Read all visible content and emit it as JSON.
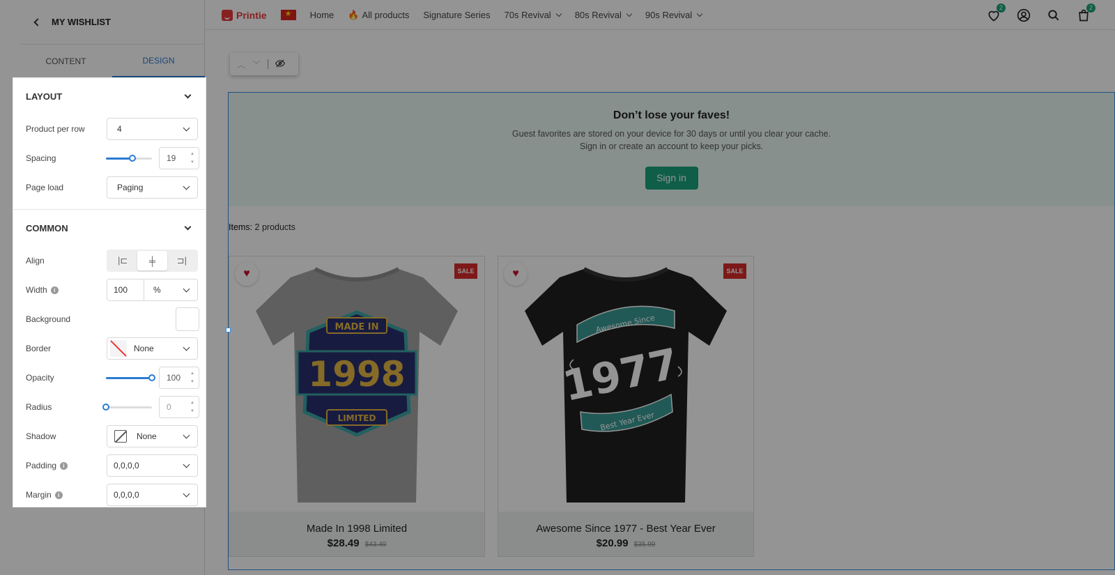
{
  "sidebar": {
    "title": "MY WISHLIST",
    "tabs": [
      {
        "label": "CONTENT"
      },
      {
        "label": "DESIGN"
      }
    ],
    "layout": {
      "heading": "LAYOUT",
      "product_per_row_label": "Product per row",
      "product_per_row_value": "4",
      "spacing_label": "Spacing",
      "spacing_value": "19",
      "spacing_level_percent": 57,
      "page_load_label": "Page load",
      "page_load_value": "Paging"
    },
    "common": {
      "heading": "COMMON",
      "align_label": "Align",
      "width_label": "Width",
      "width_value": "100",
      "width_unit": "%",
      "background_label": "Background",
      "background_color": "#ffffff",
      "border_label": "Border",
      "border_value": "None",
      "opacity_label": "Opacity",
      "opacity_value": "100",
      "opacity_level_percent": 100,
      "radius_label": "Radius",
      "radius_value": "0",
      "radius_level_percent": 0,
      "shadow_label": "Shadow",
      "shadow_value": "None",
      "padding_label": "Padding",
      "padding_value": "0,0,0,0",
      "margin_label": "Margin",
      "margin_value": "0,0,0,0"
    }
  },
  "store": {
    "brand": "Printie",
    "nav": [
      {
        "label": "Home"
      },
      {
        "label": "All products",
        "icon": "fire-icon"
      },
      {
        "label": "Signature Series"
      },
      {
        "label": "70s Revival"
      },
      {
        "label": "80s Revival"
      },
      {
        "label": "90s Revival"
      }
    ],
    "wishlist_count": "2",
    "cart_count": "2"
  },
  "wishlist": {
    "banner_title": "Don’t lose your faves!",
    "banner_line1": "Guest favorites are stored on your device for 30 days or until you clear your cache.",
    "banner_line2": "Sign in or create an account to keep your picks.",
    "signin_label": "Sign in",
    "items_label": "Items:",
    "items_value": "2 products",
    "products": [
      {
        "name": "Made In 1998 Limited",
        "price": "$28.49",
        "old_price": "$43.49",
        "badge": "SALE",
        "shirt_color": "#a4a4a4"
      },
      {
        "name": "Awesome Since 1977 - Best Year Ever",
        "price": "$20.99",
        "old_price": "$35.99",
        "badge": "SALE",
        "shirt_color": "#1f1f1f"
      }
    ]
  },
  "colors": {
    "accent": "#2a7bd3",
    "primary_green": "#1aa37a",
    "sale_red": "#d92b2b"
  }
}
